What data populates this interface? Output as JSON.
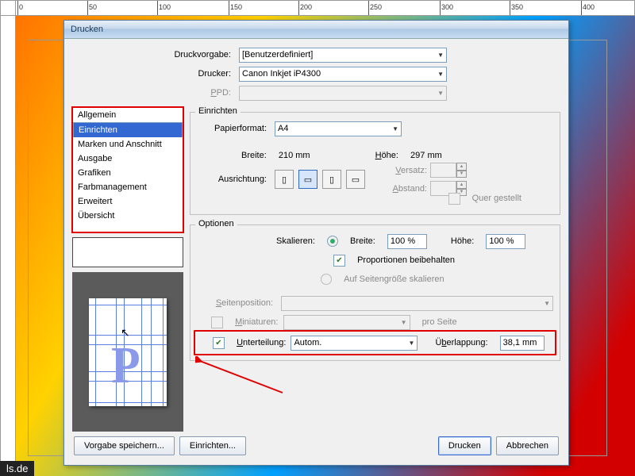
{
  "ruler": {
    "marks": [
      0,
      50,
      100,
      150,
      200,
      250,
      300,
      350,
      400
    ]
  },
  "dialog": {
    "title": "Drucken",
    "preset_label": "Druckvorgabe:",
    "preset_value": "[Benutzerdefiniert]",
    "printer_label": "Drucker:",
    "printer_value": "Canon Inkjet iP4300",
    "ppd_label": "PPD:",
    "ppd_value": ""
  },
  "sidebar": {
    "items": [
      "Allgemein",
      "Einrichten",
      "Marken und Anschnitt",
      "Ausgabe",
      "Grafiken",
      "Farbmanagement",
      "Erweitert",
      "Übersicht"
    ],
    "selected": 1
  },
  "setup": {
    "heading": "Einrichten",
    "paper_label": "Papierformat:",
    "paper_value": "A4",
    "width_label": "Breite:",
    "width_value": "210 mm",
    "height_label": "Höhe:",
    "height_value": "297 mm",
    "orient_label": "Ausrichtung:",
    "offset_label": "Versatz:",
    "gap_label": "Abstand:",
    "transverse_label": "Quer gestellt"
  },
  "options": {
    "heading": "Optionen",
    "scale_label": "Skalieren:",
    "width_radio": "Breite:",
    "width_value": "100 %",
    "height_label": "Höhe:",
    "height_value": "100 %",
    "keep_prop": "Proportionen beibehalten",
    "fit_page": "Auf Seitengröße skalieren",
    "pagepos_label": "Seitenposition:",
    "pagepos_value": "",
    "thumbs_label": "Miniaturen:",
    "thumbs_suffix": "pro Seite",
    "tile_label": "Unterteilung:",
    "tile_value": "Autom.",
    "overlap_label": "Überlappung:",
    "overlap_value": "38,1 mm"
  },
  "footer": {
    "save_preset": "Vorgabe speichern...",
    "setup_btn": "Einrichten...",
    "print_btn": "Drucken",
    "cancel_btn": "Abbrechen"
  },
  "watermark": "ls.de"
}
